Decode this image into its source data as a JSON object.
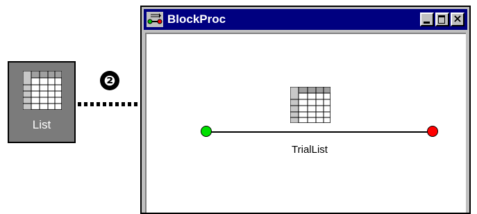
{
  "toolbox": {
    "item_label": "List",
    "icon": "grid-list-icon"
  },
  "step_marker": "❷",
  "window": {
    "title": "BlockProc",
    "icon": "block-proc-icon",
    "controls": {
      "minimize": "minimize-icon",
      "maximize": "maximize-icon",
      "close": "×"
    }
  },
  "canvas": {
    "object_label": "TrialList",
    "start_node_color": "#00e000",
    "end_node_color": "#ff0000"
  }
}
